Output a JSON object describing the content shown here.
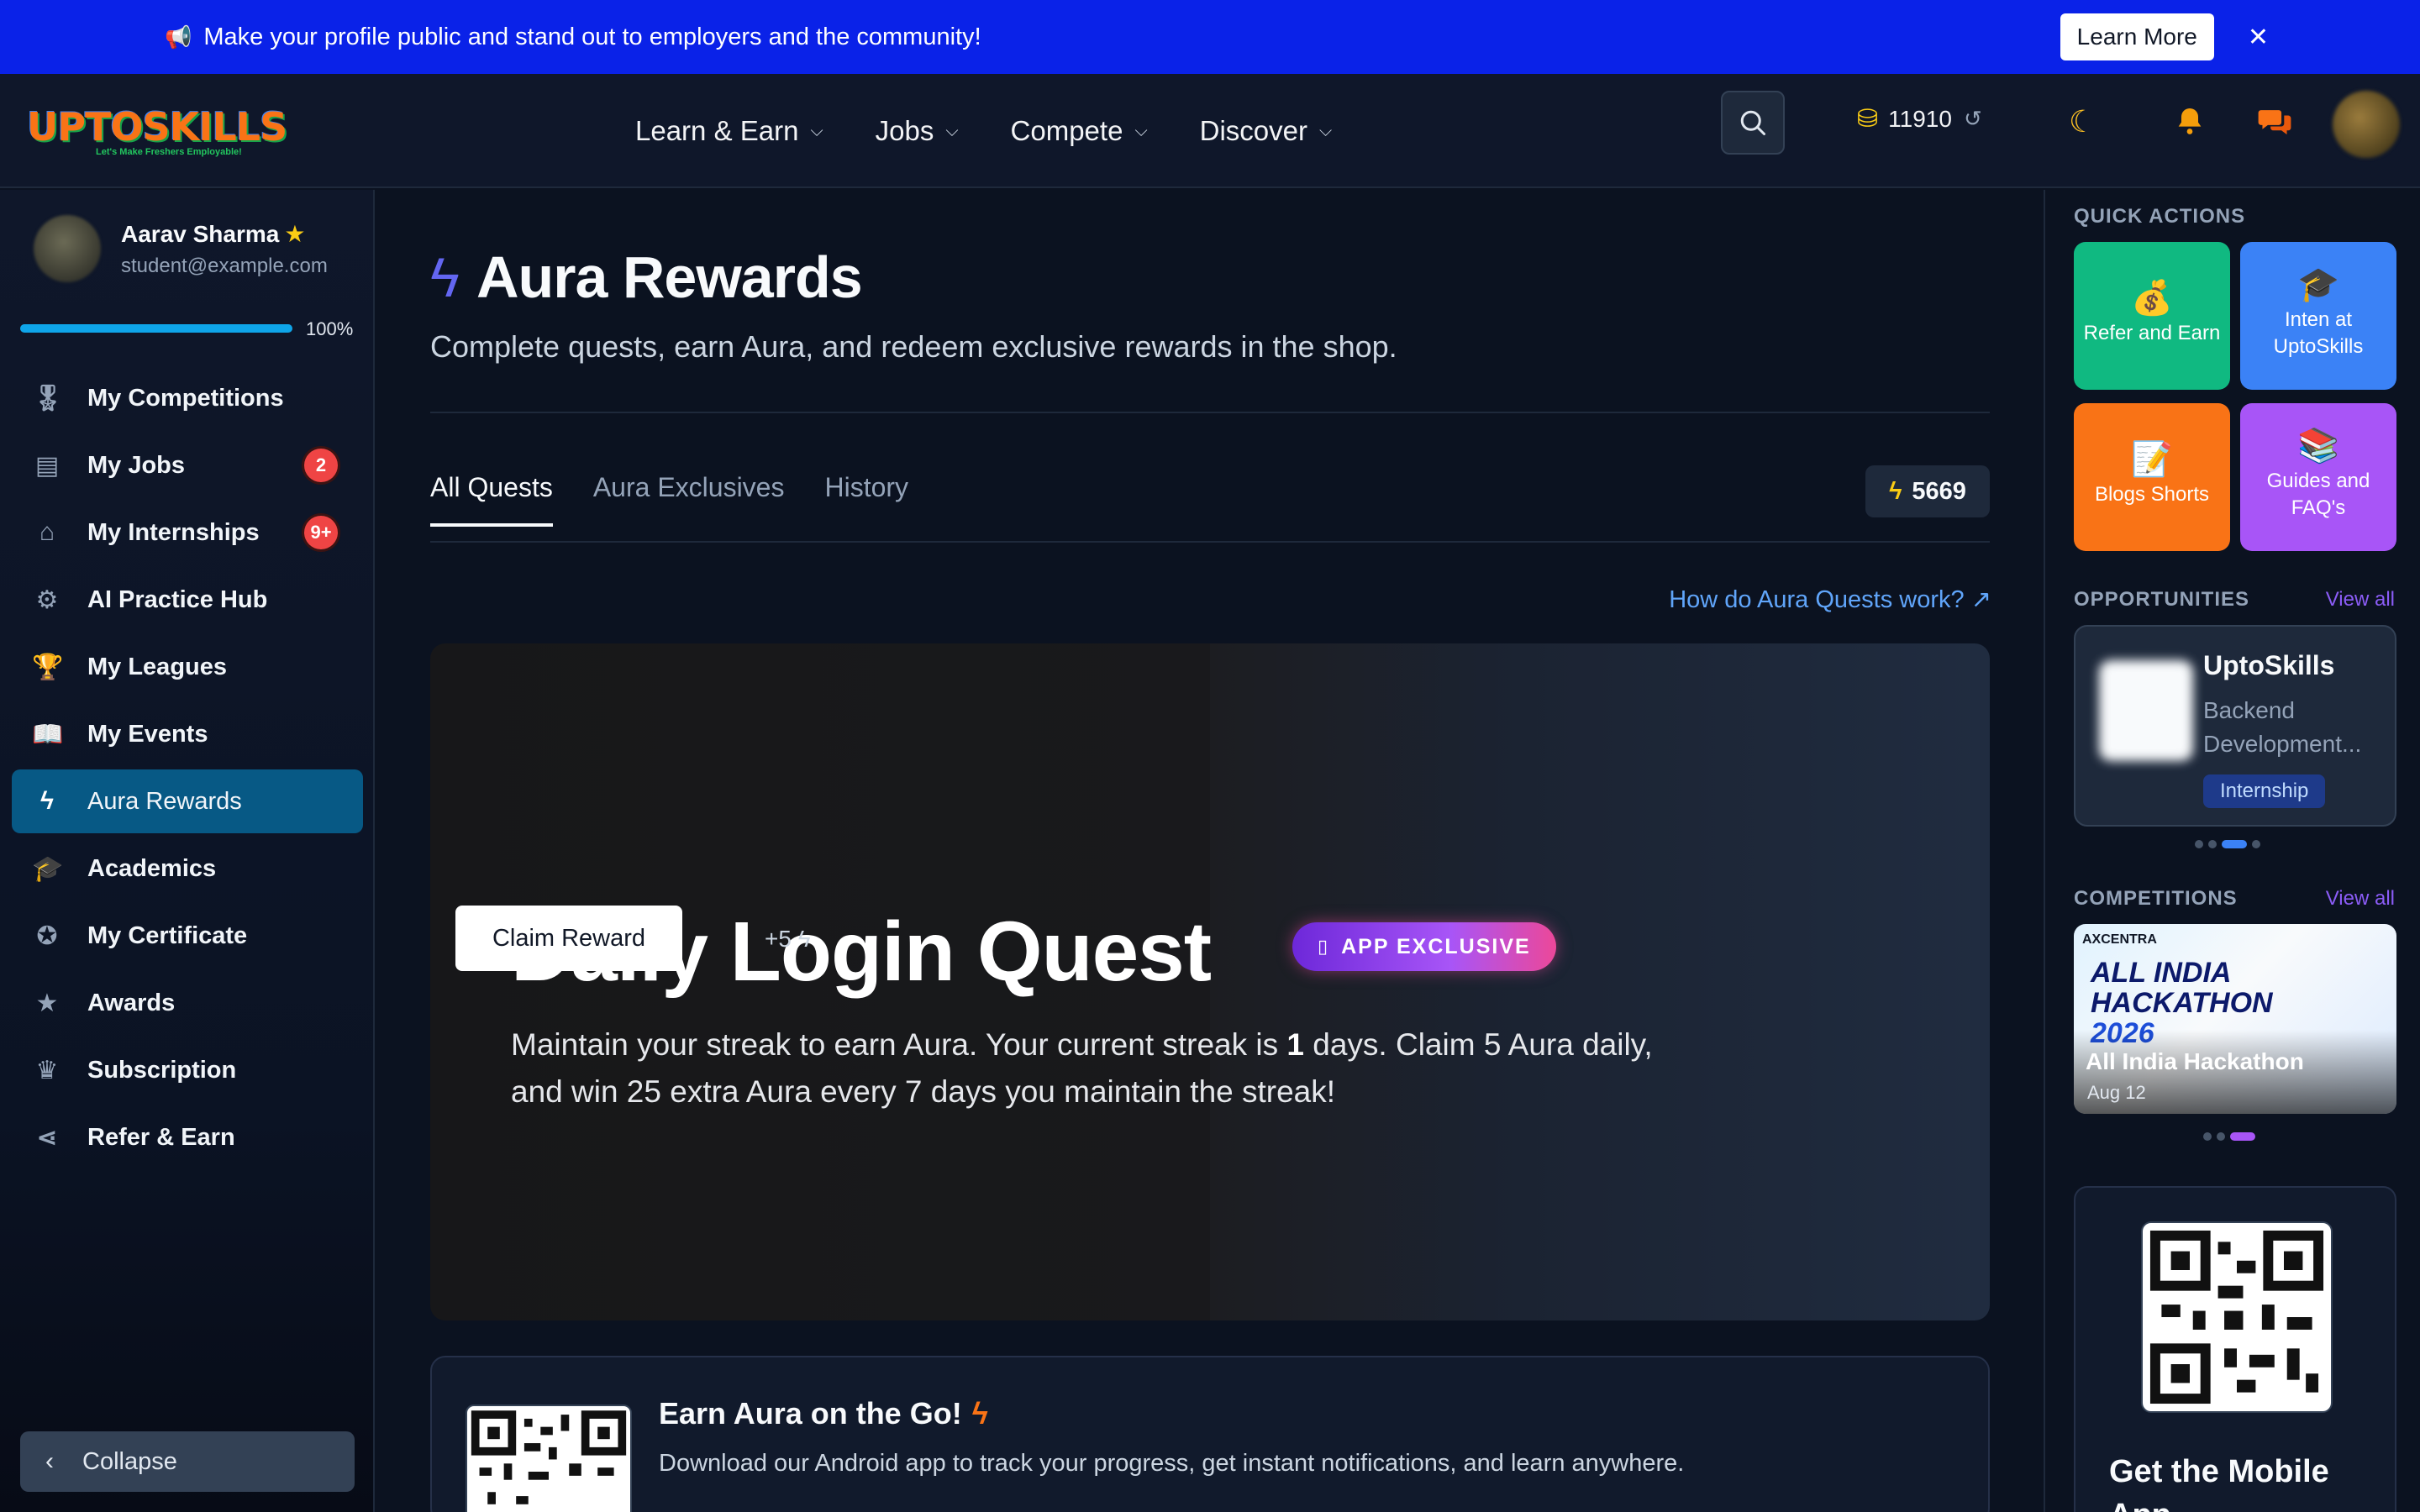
{
  "banner": {
    "icon": "megaphone-icon",
    "message": "Make your profile public and stand out to employers and the community!",
    "learn_more": "Learn More",
    "close": "✕"
  },
  "header": {
    "logo_text": "UPTOSKILLS",
    "logo_tagline": "Let's Make Freshers Employable!",
    "nav": [
      "Learn & Earn",
      "Jobs",
      "Compete",
      "Discover"
    ],
    "coins": "11910",
    "icons": [
      "search-icon",
      "coins-icon",
      "refresh-icon",
      "moon-icon",
      "bell-icon",
      "chat-icon"
    ]
  },
  "sidebar": {
    "user_name": "Aarav Sharma",
    "user_email": "student@example.com",
    "progress_label": "100%",
    "progress_value": 1.0,
    "items": [
      {
        "label": "My Competitions",
        "icon": "medal-icon"
      },
      {
        "label": "My Jobs",
        "icon": "briefcase-icon",
        "badge": "2"
      },
      {
        "label": "My Internships",
        "icon": "building-icon",
        "badge": "9+"
      },
      {
        "label": "AI Practice Hub",
        "icon": "robot-icon"
      },
      {
        "label": "My Leagues",
        "icon": "trophy-icon"
      },
      {
        "label": "My Events",
        "icon": "book-icon"
      },
      {
        "label": "Aura Rewards",
        "icon": "bolt-icon",
        "active": true
      },
      {
        "label": "Academics",
        "icon": "graduation-cap-icon"
      },
      {
        "label": "My Certificate",
        "icon": "certificate-icon"
      },
      {
        "label": "Awards",
        "icon": "star-icon"
      },
      {
        "label": "Subscription",
        "icon": "crown-icon"
      },
      {
        "label": "Refer & Earn",
        "icon": "share-icon"
      }
    ],
    "collapse": "Collapse"
  },
  "main": {
    "title": "Aura Rewards",
    "subtitle": "Complete quests, earn Aura, and redeem exclusive rewards in the shop.",
    "tabs": [
      "All Quests",
      "Aura Exclusives",
      "History"
    ],
    "aura_balance": "5669",
    "how_link": "How do Aura Quests work?",
    "quest": {
      "title": "Daily Login Quest",
      "tag": "APP EXCLUSIVE",
      "desc_part1": "Maintain your streak to earn Aura. Your current streak is ",
      "streak": "1",
      "desc_part2": " days. Claim 5 Aura daily, and win 25 extra Aura every 7 days you maintain the streak!",
      "claim": "Claim Reward",
      "reward": "+5"
    },
    "go_card": {
      "title": "Earn Aura on the Go!",
      "desc": "Download our Android app to track your progress, get instant notifications, and learn anywhere."
    }
  },
  "right": {
    "quick_actions_title": "QUICK ACTIONS",
    "quick_actions": [
      {
        "label": "Refer and Earn",
        "color": "#10b981",
        "icon": "money-bag-icon"
      },
      {
        "label": "Inten at UptoSkills",
        "color": "#3b82f6",
        "icon": "graduation-cap-icon"
      },
      {
        "label": "Blogs Shorts",
        "color": "#f97316",
        "icon": "document-icon"
      },
      {
        "label": "Guides and FAQ's",
        "color": "#a855f7",
        "icon": "books-icon"
      }
    ],
    "opportunities_title": "OPPORTUNITIES",
    "view_all": "View all",
    "opportunity": {
      "org": "UptoSkills",
      "role": "Backend Development...",
      "type": "Internship"
    },
    "competitions_title": "COMPETITIONS",
    "competition": {
      "brand": "AXCENTRA",
      "banner_line1": "ALL INDIA",
      "banner_line2": "HACKATHON",
      "banner_year": "2026",
      "title": "All India Hackathon",
      "date": "Aug 12"
    },
    "mobile_title": "Get the Mobile App"
  }
}
